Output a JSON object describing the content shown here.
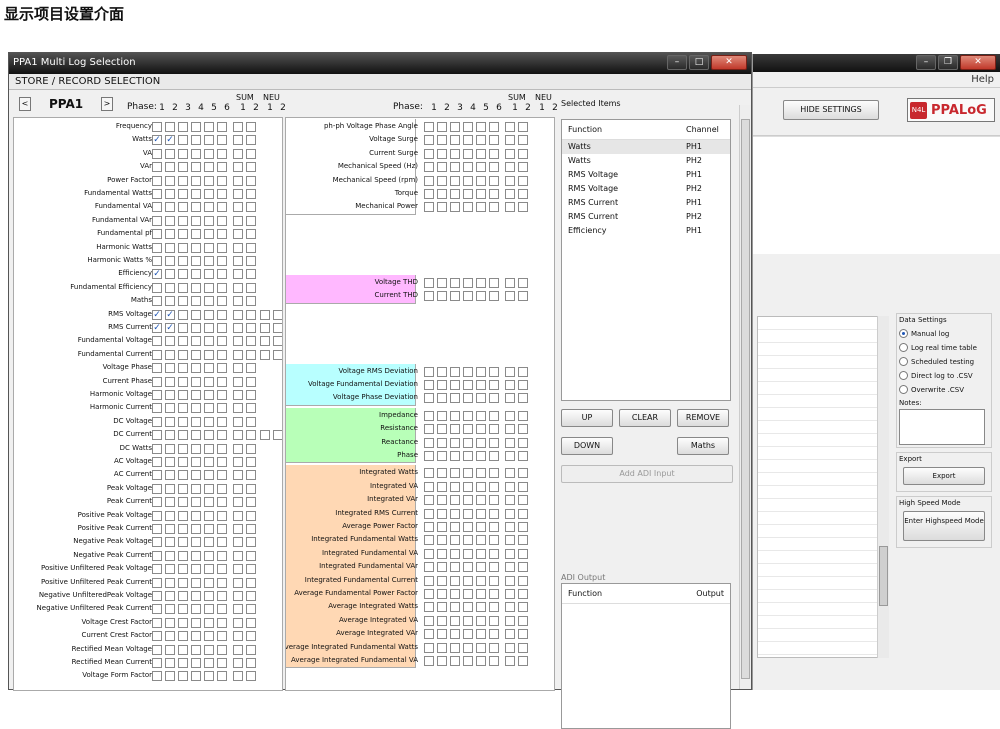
{
  "doc_title": "显示项目设置介面",
  "bg_window": {
    "menu_help": "Help",
    "hide_settings": "HIDE SETTINGS",
    "logo": "PPALoG",
    "logo_mark": "N4L",
    "data_settings": {
      "title": "Data Settings",
      "options": [
        "Manual log",
        "Log real time table",
        "Scheduled testing",
        "Direct log to .CSV",
        "Overwrite .CSV"
      ],
      "selected": "Manual log",
      "notes_label": "Notes:",
      "export_label": "Export",
      "export_button": "Export",
      "hs_label": "High Speed Mode",
      "hs_button": "Enter Highspeed Mode"
    }
  },
  "window": {
    "title": "PPA1 Multi Log Selection",
    "subtitle": "STORE / RECORD SELECTION",
    "instrument": "PPA1",
    "phase_label": "Phase:",
    "headers": {
      "sum": "SUM",
      "neu": "NEU"
    },
    "phase_numbers": [
      "1",
      "2",
      "3",
      "4",
      "5",
      "6",
      "1",
      "2",
      "1",
      "2"
    ],
    "left_rows": [
      {
        "label": "Frequency",
        "checked": []
      },
      {
        "label": "Watts",
        "checked": [
          0,
          1
        ]
      },
      {
        "label": "VA",
        "checked": []
      },
      {
        "label": "VAr",
        "checked": []
      },
      {
        "label": "Power Factor",
        "checked": []
      },
      {
        "label": "Fundamental Watts",
        "checked": []
      },
      {
        "label": "Fundamental VA",
        "checked": []
      },
      {
        "label": "Fundamental VAr",
        "checked": []
      },
      {
        "label": "Fundamental pf",
        "checked": []
      },
      {
        "label": "Harmonic Watts",
        "checked": []
      },
      {
        "label": "Harmonic Watts %",
        "checked": []
      },
      {
        "label": "Efficiency",
        "checked": [
          0
        ]
      },
      {
        "label": "Fundamental Efficiency",
        "checked": []
      },
      {
        "label": "Maths",
        "checked": []
      },
      {
        "label": "RMS Voltage",
        "checked": [
          0,
          1
        ]
      },
      {
        "label": "RMS Current",
        "checked": [
          0,
          1
        ]
      },
      {
        "label": "Fundamental Voltage",
        "checked": []
      },
      {
        "label": "Fundamental Current",
        "checked": []
      },
      {
        "label": "Voltage Phase",
        "checked": []
      },
      {
        "label": "Current Phase",
        "checked": []
      },
      {
        "label": "Harmonic Voltage",
        "checked": []
      },
      {
        "label": "Harmonic Current",
        "checked": []
      },
      {
        "label": "DC Voltage",
        "checked": []
      },
      {
        "label": "DC Current",
        "checked": []
      },
      {
        "label": "DC Watts",
        "checked": []
      },
      {
        "label": "AC Voltage",
        "checked": []
      },
      {
        "label": "AC Current",
        "checked": []
      },
      {
        "label": "Peak Voltage",
        "checked": []
      },
      {
        "label": "Peak Current",
        "checked": []
      },
      {
        "label": "Positive Peak Voltage",
        "checked": []
      },
      {
        "label": "Positive Peak Current",
        "checked": []
      },
      {
        "label": "Negative Peak Voltage",
        "checked": []
      },
      {
        "label": "Negative Peak Current",
        "checked": []
      },
      {
        "label": "Positive Unfiltered Peak Voltage",
        "checked": []
      },
      {
        "label": "Positive Unfiltered Peak Current",
        "checked": []
      },
      {
        "label": "Negative UnfilteredPeak Voltage",
        "checked": []
      },
      {
        "label": "Negative Unfiltered Peak Current",
        "checked": []
      },
      {
        "label": "Voltage Crest Factor",
        "checked": []
      },
      {
        "label": "Current Crest Factor",
        "checked": []
      },
      {
        "label": "Rectified Mean Voltage",
        "checked": []
      },
      {
        "label": "Rectified Mean Current",
        "checked": []
      },
      {
        "label": "Voltage Form Factor",
        "checked": []
      }
    ],
    "right_groups": [
      {
        "color": "#ffffff",
        "rows": [
          "ph-ph Voltage Phase Angle",
          "Voltage Surge",
          "Current Surge",
          "Mechanical Speed (Hz)",
          "Mechanical Speed (rpm)",
          "Torque",
          "Mechanical Power"
        ]
      },
      {
        "color": "#ffb8ff",
        "rows": [
          "Voltage THD",
          "Current THD"
        ]
      },
      {
        "color": "#b8ffff",
        "rows": [
          "Voltage RMS Deviation",
          "Voltage Fundamental Deviation",
          "Voltage Phase Deviation"
        ]
      },
      {
        "color": "#b8ffb8",
        "rows": [
          "Impedance",
          "Resistance",
          "Reactance",
          "Phase"
        ]
      },
      {
        "color": "#ffd8b4",
        "rows": [
          "Integrated Watts",
          "Integrated VA",
          "Integrated VAr",
          "Integrated RMS Current",
          "Average Power Factor",
          "Integrated Fundamental Watts",
          "Integrated Fundamental VA",
          "Integrated Fundamental VAr",
          "Integrated Fundamental Current",
          "Average Fundamental Power Factor",
          "Average Integrated Watts",
          "Average Integrated VA",
          "Average Integrated VAr",
          "Average Integrated Fundamental Watts",
          "Average Integrated Fundamental VA"
        ]
      }
    ],
    "selected_items": {
      "label": "Selected Items",
      "col_function": "Function",
      "col_channel": "Channel",
      "rows": [
        {
          "function": "Watts",
          "channel": "PH1"
        },
        {
          "function": "Watts",
          "channel": "PH2"
        },
        {
          "function": "RMS Voltage",
          "channel": "PH1"
        },
        {
          "function": "RMS Voltage",
          "channel": "PH2"
        },
        {
          "function": "RMS Current",
          "channel": "PH1"
        },
        {
          "function": "RMS Current",
          "channel": "PH2"
        },
        {
          "function": "Efficiency",
          "channel": "PH1"
        }
      ]
    },
    "buttons": {
      "up": "UP",
      "clear": "CLEAR",
      "remove": "REMOVE",
      "down": "DOWN",
      "maths": "Maths",
      "add_adi": "Add ADI Input"
    },
    "adi": {
      "label": "ADI Output",
      "col_function": "Function",
      "col_output": "Output"
    }
  }
}
